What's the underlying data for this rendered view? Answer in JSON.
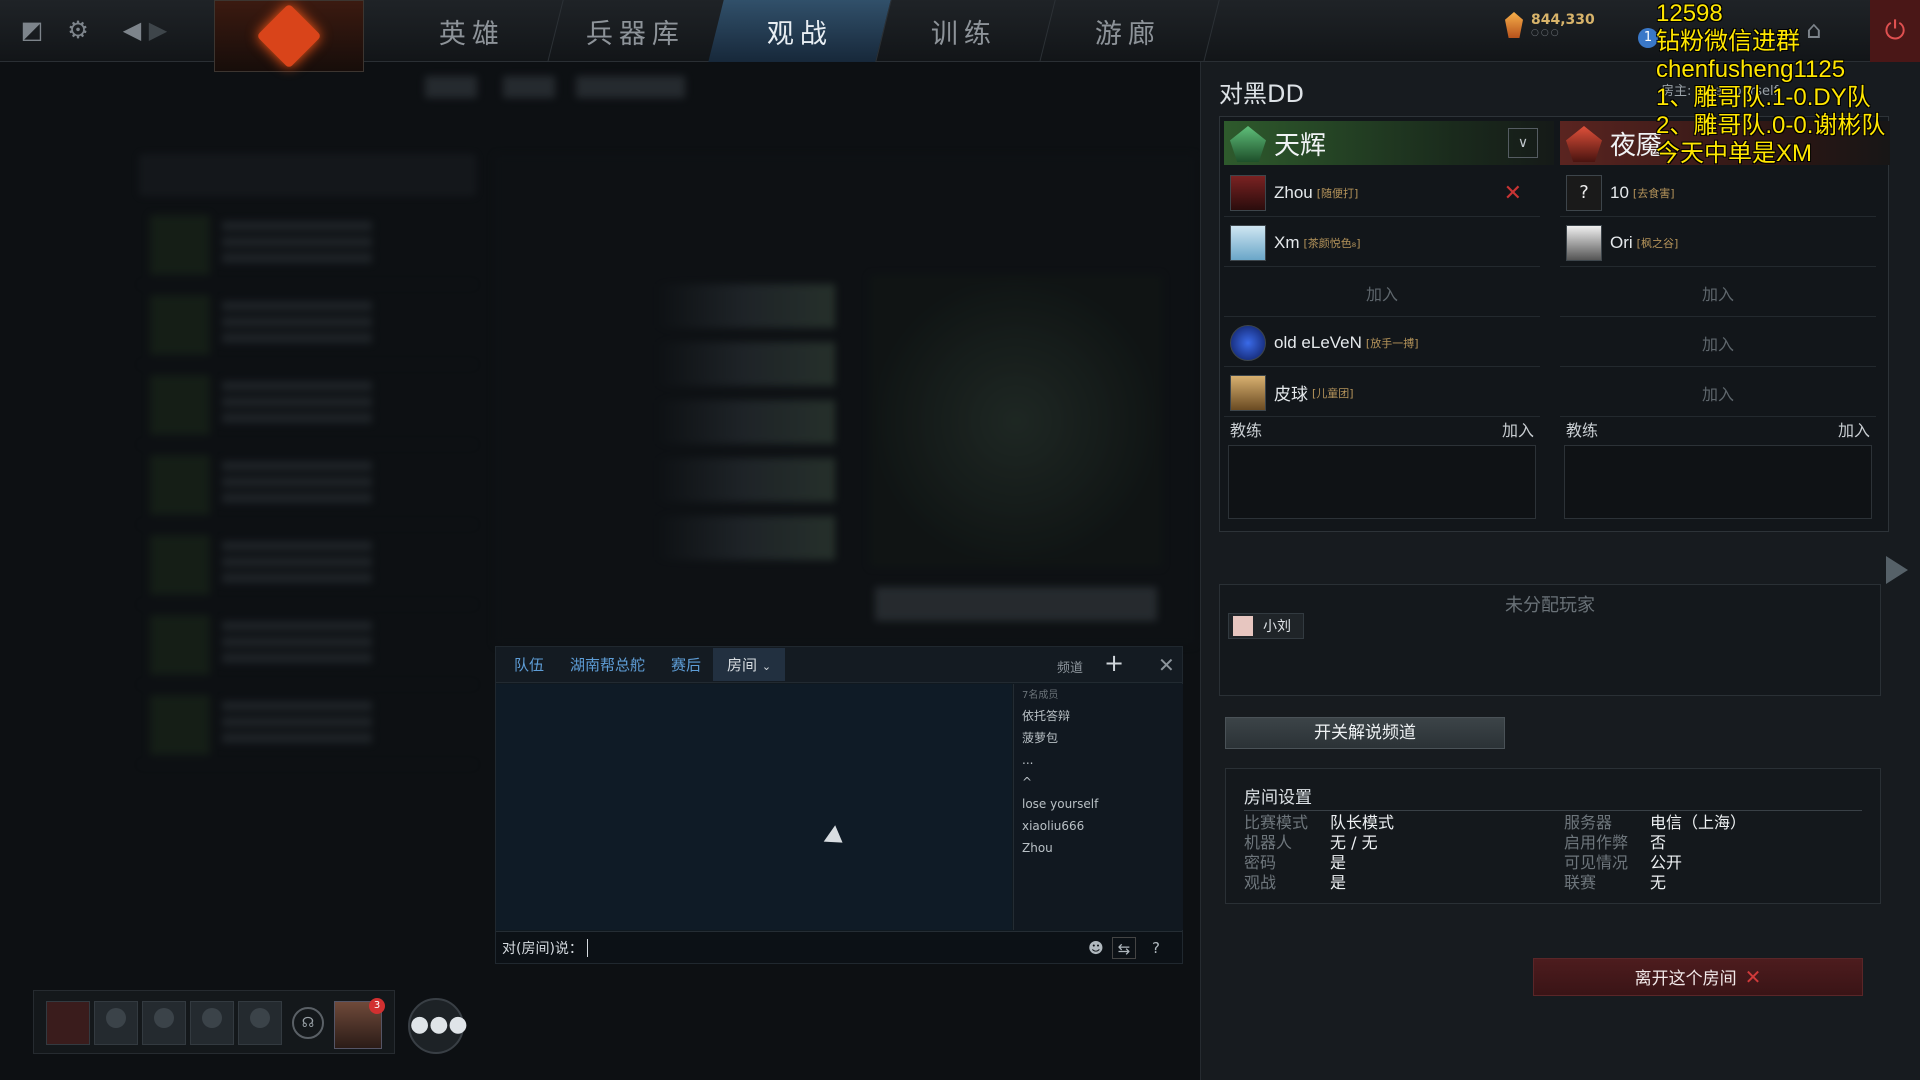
{
  "topbar": {
    "tabs": [
      {
        "label": "英雄",
        "active": false
      },
      {
        "label": "兵器库",
        "active": false
      },
      {
        "label": "观战",
        "active": true
      },
      {
        "label": "训练",
        "active": false
      },
      {
        "label": "游廊",
        "active": false
      }
    ],
    "shards": "844,330",
    "shard_dots": "○○○",
    "notification_count": "1"
  },
  "chat": {
    "tabs": [
      "队伍",
      "湖南帮总舵",
      "赛后",
      "房间"
    ],
    "channel_label": "频道",
    "members_count": "7名成员",
    "members": [
      "依托答辩",
      "菠萝包",
      "...",
      "^",
      "lose yourself",
      "xiaoliu666",
      "Zhou"
    ],
    "input_prefix": "对(房间)说："
  },
  "party": {
    "friend_badge": "3"
  },
  "lobby": {
    "title": "对黑DD",
    "host_partial": "房主: lose yourself",
    "radiant": {
      "name": "天辉",
      "slots": [
        {
          "name": "Zhou",
          "guild": "[随便打]",
          "filled": true
        },
        {
          "name": "Xm",
          "guild": "[茶颜悦色₈]",
          "filled": true
        },
        {
          "name": "加入",
          "guild": "",
          "filled": false
        },
        {
          "name": "old eLeVeN",
          "guild": "[放手一搏]",
          "filled": true
        },
        {
          "name": "皮球",
          "guild": "[儿童团]",
          "filled": true
        }
      ]
    },
    "dire": {
      "name": "夜魇",
      "slots": [
        {
          "name": "10",
          "guild": "[去食害]",
          "filled": true
        },
        {
          "name": "Ori",
          "guild": "[枫之谷]",
          "filled": true
        },
        {
          "name": "加入",
          "guild": "",
          "filled": false
        },
        {
          "name": "加入",
          "guild": "",
          "filled": false
        },
        {
          "name": "加入",
          "guild": "",
          "filled": false
        }
      ]
    },
    "coach_label": "教练",
    "join_label": "加入",
    "unassigned_header": "未分配玩家",
    "unassigned_player": "小刘",
    "caster_button": "开关解说频道",
    "settings": {
      "header": "房间设置",
      "left": [
        {
          "k": "比赛模式",
          "v": "队长模式"
        },
        {
          "k": "机器人",
          "v": "无 / 无"
        },
        {
          "k": "密码",
          "v": "是"
        },
        {
          "k": "观战",
          "v": "是"
        }
      ],
      "right": [
        {
          "k": "服务器",
          "v": "电信（上海）"
        },
        {
          "k": "启用作弊",
          "v": "否"
        },
        {
          "k": "可见情况",
          "v": "公开"
        },
        {
          "k": "联赛",
          "v": "无"
        }
      ]
    },
    "leave_button": "离开这个房间"
  },
  "overlay": {
    "lines": [
      "12598",
      "钻粉微信进群",
      "chenfusheng1125",
      "1、雕哥队.1-0.DY队",
      "2、雕哥队.0-0.谢彬队",
      "今天中单是XM"
    ]
  },
  "colors": {
    "accent_blue": "#31506a",
    "radiant": "#2e5a2c",
    "dire": "#5a2420",
    "overlay_yellow": "#ffe600"
  }
}
